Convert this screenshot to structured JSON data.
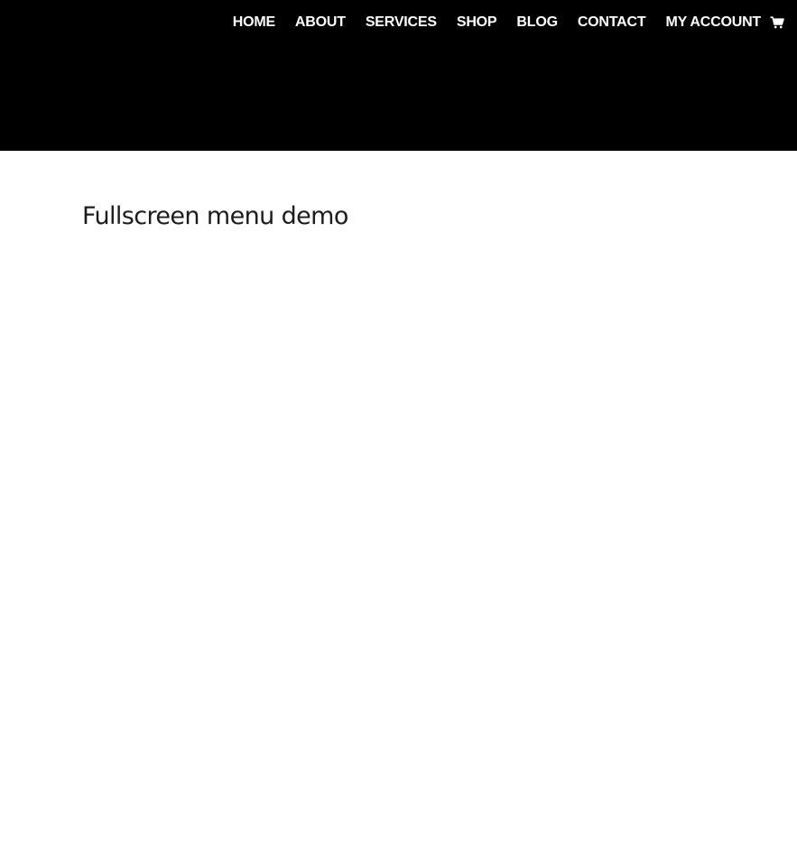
{
  "nav": {
    "items": [
      {
        "label": "HOME"
      },
      {
        "label": "ABOUT"
      },
      {
        "label": "SERVICES"
      },
      {
        "label": "SHOP"
      },
      {
        "label": "BLOG"
      },
      {
        "label": "CONTACT"
      },
      {
        "label": "MY ACCOUNT"
      }
    ],
    "cart_icon": "cart-icon"
  },
  "page": {
    "title": "Fullscreen menu demo"
  },
  "colors": {
    "header_bg": "#000000",
    "nav_text": "#ffffff",
    "page_bg": "#ffffff",
    "title_text": "#1c1c1c"
  }
}
